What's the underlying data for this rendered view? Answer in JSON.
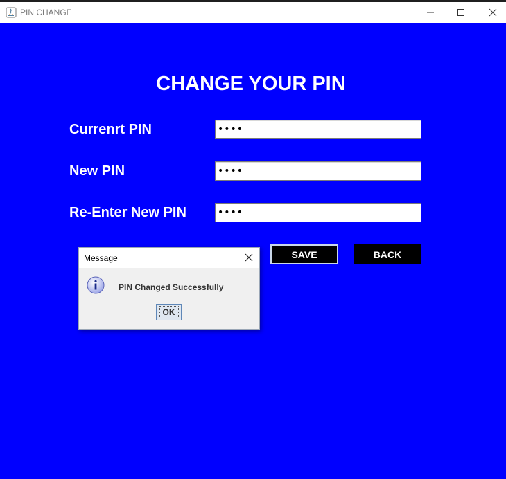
{
  "window": {
    "title": "PIN CHANGE"
  },
  "form": {
    "heading": "CHANGE YOUR PIN",
    "current_pin_label": "Currenrt PIN",
    "current_pin_value": "••••",
    "new_pin_label": "New PIN",
    "new_pin_value": "••••",
    "reenter_pin_label": "Re-Enter New PIN",
    "reenter_pin_value": "••••",
    "save_label": "SAVE",
    "back_label": "BACK"
  },
  "dialog": {
    "title": "Message",
    "message": "PIN Changed Successfully",
    "ok_label": "OK",
    "icon": "info-icon"
  },
  "colors": {
    "background": "#0000ff",
    "button_bg": "#000000",
    "text": "#ffffff"
  }
}
